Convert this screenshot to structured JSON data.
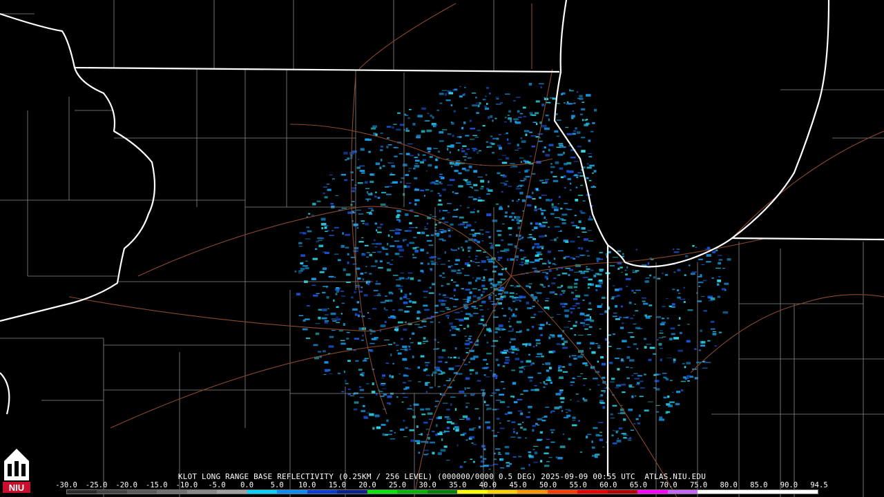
{
  "product": {
    "caption": "KLOT LONG RANGE BASE REFLECTIVITY (0.25KM / 256 LEVEL) (000000/0000 0.5 DEG) 2025-09-09 00:55 UTC  ATLAS.NIU.EDU"
  },
  "scale": {
    "ticks": [
      "-30.0",
      "-25.0",
      "-20.0",
      "-15.0",
      "-10.0",
      "-5.0",
      "0.0",
      "5.0",
      "10.0",
      "15.0",
      "20.0",
      "25.0",
      "30.0",
      "35.0",
      "40.0",
      "45.0",
      "50.0",
      "55.0",
      "60.0",
      "65.0",
      "70.0",
      "75.0",
      "80.0",
      "85.0",
      "90.0",
      "94.5"
    ],
    "colors": [
      "#2b2b2b",
      "#444444",
      "#5a5a5a",
      "#707070",
      "#888888",
      "#a0a0a0",
      "#06d2ff",
      "#0a8cf5",
      "#0a3ccf",
      "#08228a",
      "#05e605",
      "#06b406",
      "#058205",
      "#ffff00",
      "#ffd200",
      "#ff9600",
      "#ff3c00",
      "#e60000",
      "#b40000",
      "#ff00ff",
      "#c864ff",
      "#ffffff",
      "#ffffff",
      "#ffffff",
      "#ffffff"
    ]
  },
  "logo": {
    "text": "NIU"
  },
  "colors": {
    "state_border": "#ffffff",
    "county_line": "#8a8a8a",
    "road": "#8b4a2b",
    "echo_light": "#2ed8e8",
    "echo_mid": "#1a9ce8",
    "echo_dark": "#1a55d8"
  }
}
